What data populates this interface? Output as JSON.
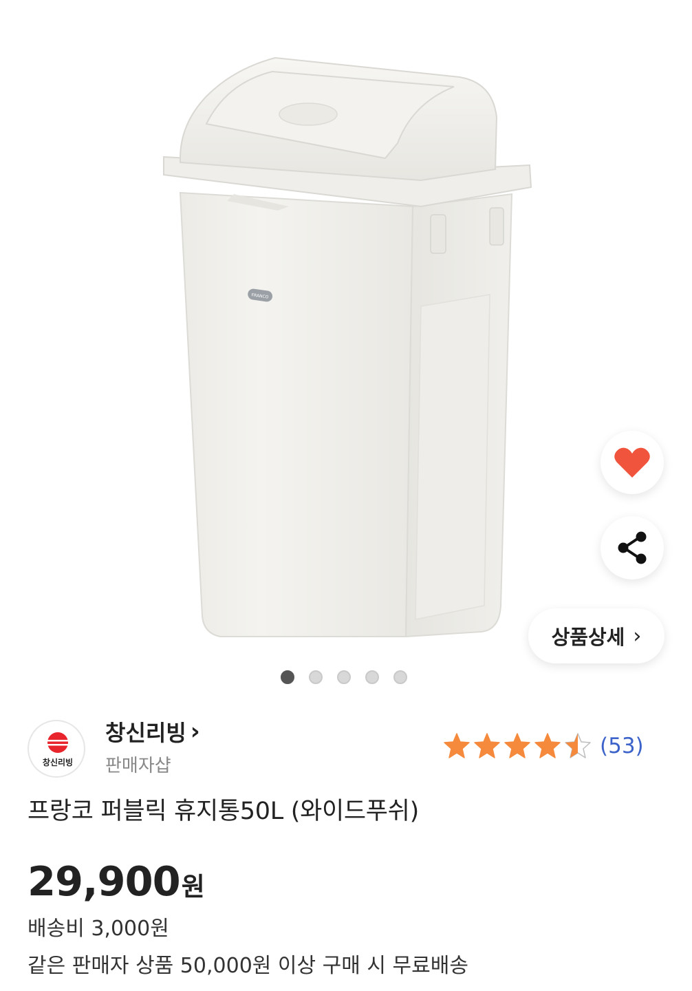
{
  "product_image": {
    "brand_plate": "FRANCO",
    "carousel": {
      "total": 5,
      "active_index": 0
    }
  },
  "actions": {
    "like_icon": "heart-icon",
    "share_icon": "share-icon",
    "detail_label": "상품상세",
    "detail_chevron": "›"
  },
  "seller": {
    "logo_text": "창신리빙",
    "name": "창신리빙",
    "name_chevron": "›",
    "type": "판매자샵"
  },
  "rating": {
    "stars": 4.5,
    "max": 5,
    "review_count": "(53)"
  },
  "product": {
    "title": "프랑코 퍼블릭 휴지통50L (와이드푸쉬)",
    "price": "29,900",
    "price_unit": "원",
    "shipping": "배송비 3,000원",
    "free_shipping": "같은 판매자 상품 50,000원 이상 구매 시 무료배송"
  },
  "colors": {
    "star": "#f58a3c",
    "heart": "#f0543c",
    "review_link": "#3c63c9"
  }
}
